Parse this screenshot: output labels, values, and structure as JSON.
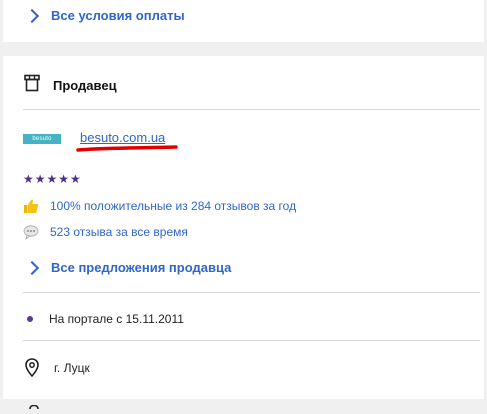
{
  "payment": {
    "all_conditions_label": "Все условия оплаты"
  },
  "seller": {
    "section_title": "Продавец",
    "logo_text": "besuto",
    "name": "besuto.com.ua",
    "stars": "★★★★★",
    "rating": 5,
    "positive_reviews_text": "100% положительные из 284 отзывов за год",
    "all_reviews_text": "523 отзыва за все время",
    "all_offers_label": "Все предложения продавца",
    "on_portal_text": "На портале с 15.11.2011",
    "city": "г. Луцк"
  },
  "colors": {
    "link": "#2f66c9",
    "star": "#4d2f8d",
    "underline_mark": "#e00000",
    "logo_bg": "#45b3c4"
  },
  "icons": {
    "store": "store-icon",
    "thumbs_up": "thumbs-up-icon",
    "comment": "speech-bubble-icon",
    "location": "location-pin-icon"
  }
}
